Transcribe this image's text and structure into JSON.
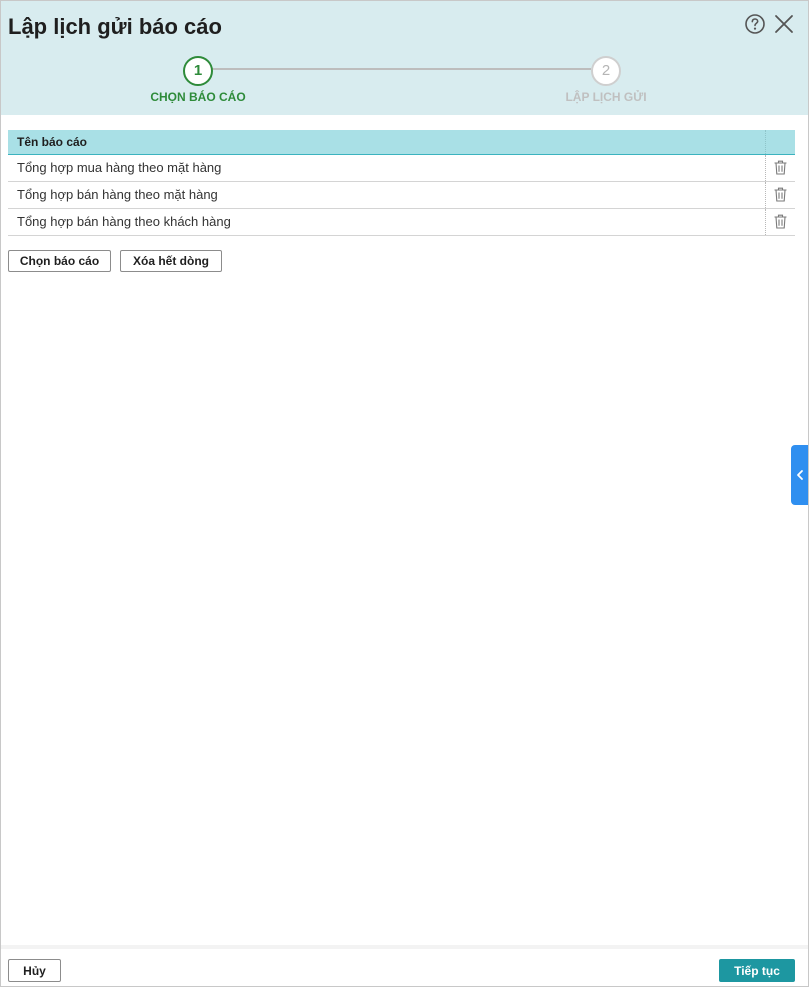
{
  "dialog": {
    "title": "Lập lịch gửi báo cáo"
  },
  "steps": [
    {
      "number": "1",
      "label": "CHỌN BÁO CÁO",
      "active": true
    },
    {
      "number": "2",
      "label": "LẬP LỊCH GỬI",
      "active": false
    }
  ],
  "grid": {
    "column_header": "Tên báo cáo",
    "rows": [
      {
        "name": "Tổng hợp mua hàng theo mặt hàng",
        "action_icon": "trash-icon"
      },
      {
        "name": "Tổng hợp bán hàng theo mặt hàng",
        "action_icon": "trash-icon"
      },
      {
        "name": "Tổng hợp bán hàng theo khách hàng",
        "action_icon": "trash-icon"
      }
    ]
  },
  "actions": {
    "choose_report": "Chọn báo cáo",
    "clear_rows": "Xóa hết dòng"
  },
  "footer": {
    "cancel": "Hủy",
    "next": "Tiếp tục"
  },
  "icons": {
    "help": "help-icon",
    "close": "close-icon",
    "side_panel": "chevron-left-icon"
  },
  "colors": {
    "header_bg": "#d8ecef",
    "active_step": "#2e8b3a",
    "inactive_step": "#c0c0c0",
    "grid_header_bg": "#a9e0e6",
    "primary_button": "#1d97a1",
    "side_tab": "#2f8ff0"
  }
}
